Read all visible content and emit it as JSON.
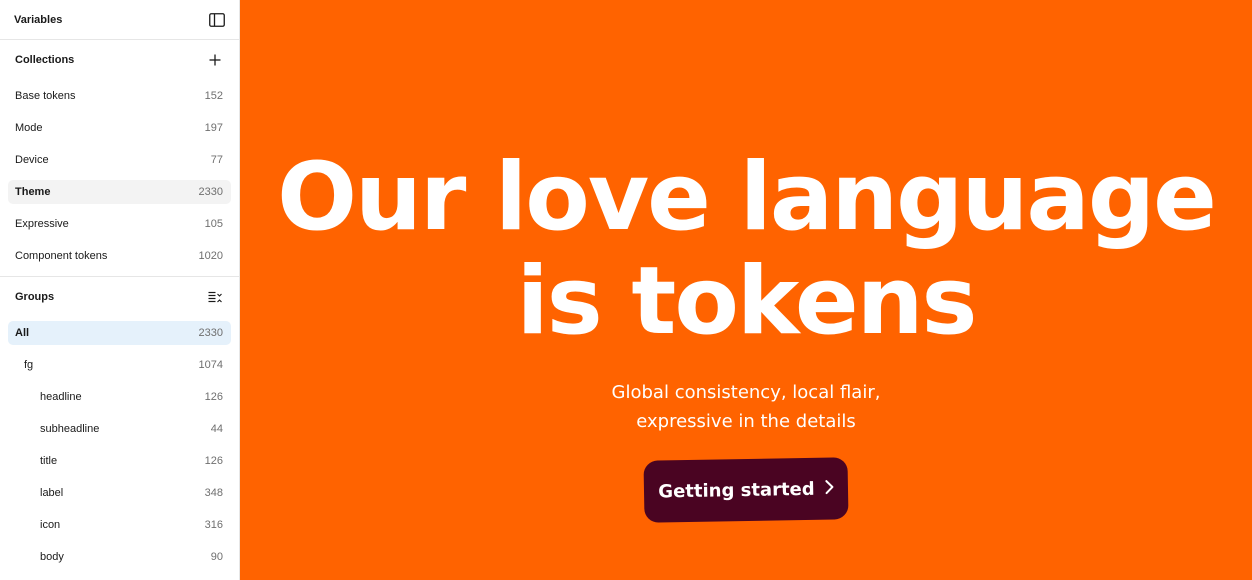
{
  "sidebar": {
    "title": "Variables",
    "collections": {
      "title": "Collections",
      "items": [
        {
          "label": "Base tokens",
          "count": "152"
        },
        {
          "label": "Mode",
          "count": "197"
        },
        {
          "label": "Device",
          "count": "77"
        },
        {
          "label": "Theme",
          "count": "2330"
        },
        {
          "label": "Expressive",
          "count": "105"
        },
        {
          "label": "Component tokens",
          "count": "1020"
        }
      ]
    },
    "groups": {
      "title": "Groups",
      "items": [
        {
          "label": "All",
          "count": "2330"
        },
        {
          "label": "fg",
          "count": "1074"
        },
        {
          "label": "headline",
          "count": "126"
        },
        {
          "label": "subheadline",
          "count": "44"
        },
        {
          "label": "title",
          "count": "126"
        },
        {
          "label": "label",
          "count": "348"
        },
        {
          "label": "icon",
          "count": "316"
        },
        {
          "label": "body",
          "count": "90"
        }
      ]
    },
    "icons": {
      "toggle": "sidebar-toggle-icon",
      "add": "plus-icon",
      "collapse": "collapse-list-icon"
    }
  },
  "hero": {
    "headline_line1": "Our love language",
    "headline_line2": "is tokens",
    "subline_line1": "Global consistency, local flair,",
    "subline_line2": "expressive in the details",
    "cta_label": "Getting started",
    "colors": {
      "background": "#ff6300",
      "cta": "#4a0422",
      "text": "#ffffff"
    }
  }
}
